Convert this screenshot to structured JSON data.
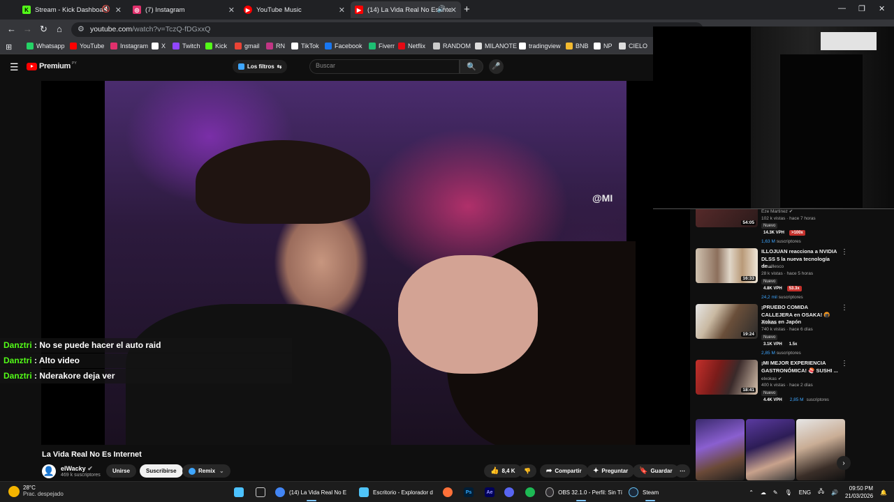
{
  "browser": {
    "tabs": [
      {
        "title": "Stream - Kick Dashboard",
        "icon": "kick-icon",
        "color": "#53fc18"
      },
      {
        "title": "(7) Instagram",
        "icon": "instagram-icon",
        "color": "#e1306c"
      },
      {
        "title": "YouTube Music",
        "icon": "youtube-music-icon",
        "color": "#ff0000"
      },
      {
        "title": "(14) La Vida Real No Es Inte",
        "icon": "youtube-icon",
        "color": "#ff0000",
        "active": true
      }
    ],
    "url_host": "youtube.com",
    "url_path": "/watch?v=TczQ-fDGxxQ",
    "bookmarks": [
      {
        "label": "Whatsapp",
        "color": "#25d366"
      },
      {
        "label": "YouTube",
        "color": "#ff0000"
      },
      {
        "label": "Instagram",
        "color": "#e1306c"
      },
      {
        "label": "X",
        "color": "#ffffff"
      },
      {
        "label": "Twitch",
        "color": "#9146ff"
      },
      {
        "label": "Kick",
        "color": "#53fc18"
      },
      {
        "label": "gmail",
        "color": "#ea4335"
      },
      {
        "label": "RN",
        "color": "#c13584"
      },
      {
        "label": "TikTok",
        "color": "#ffffff"
      },
      {
        "label": "Facebook",
        "color": "#1877f2"
      },
      {
        "label": "Fiverr",
        "color": "#1dbf73"
      },
      {
        "label": "Netflix",
        "color": "#e50914"
      },
      {
        "label": "RANDOM",
        "color": "#cccccc"
      },
      {
        "label": "MILANOTE",
        "color": "#dddddd"
      },
      {
        "label": "tradingview",
        "color": "#ffffff"
      },
      {
        "label": "BNB",
        "color": "#f3ba2f"
      },
      {
        "label": "NP",
        "color": "#ffffff"
      },
      {
        "label": "CIELO",
        "color": "#dddddd"
      }
    ]
  },
  "youtube": {
    "logo_text": "Premium",
    "logo_badge": "PY",
    "filter_label": "Los filtros",
    "search_placeholder": "Buscar"
  },
  "video": {
    "watermark": "@MI",
    "title": "La Vida Real No Es Internet",
    "channel": "elWacky",
    "subscribers": "469 k suscriptores",
    "join_label": "Unirse",
    "subscribe_label": "Suscribirse",
    "remix_label": "Remix",
    "likes": "8,4 K",
    "share_label": "Compartir",
    "ask_label": "Preguntar",
    "save_label": "Guardar"
  },
  "chat": [
    {
      "user": "Danztri",
      "message": "No se puede hacer el auto raid"
    },
    {
      "user": "Danztri",
      "message": "Alto video"
    },
    {
      "user": "Danztri",
      "message": "Nderakore deja ver"
    }
  ],
  "recommendations": [
    {
      "title": "",
      "channel": "Eze Martinez",
      "meta": "102 k vistas · hace 7 horas",
      "badge": "Nuevo",
      "vph": "14.3K VPH",
      "ratio": ">100x",
      "subs_num": "1,63 M",
      "subs_label": "suscriptores",
      "duration": "54:05"
    },
    {
      "title": "ILLOJUAN reacciona a NVIDIA DLSS 5 la nueva tecnología de...",
      "channel": "canalllesco",
      "meta": "28 k vistas · hace 5 horas",
      "badge": "Nuevo",
      "vph": "4.8K VPH",
      "ratio": "53.3x",
      "subs_num": "24,2 mil",
      "subs_label": "suscriptores",
      "duration": "16:33"
    },
    {
      "title": "¡PRUEBO COMIDA CALLEJERA en OSAKA! 🍘 Xokas en Japón",
      "channel": "elxokas",
      "meta": "740 k vistas · hace 6 días",
      "badge": "Nuevo",
      "vph": "3.1K VPH",
      "ratio": "1.5x",
      "subs_num": "2,85 M",
      "subs_label": "suscriptores",
      "duration": "19:24"
    },
    {
      "title": "¡MI MEJOR EXPERIENCIA GASTRONÓMICA! 🍣 SUSHI ...",
      "channel": "elxokas",
      "meta": "400 k vistas · hace 2 días",
      "badge": "Nuevo",
      "vph": "4.4K VPH",
      "ratio": "",
      "subs_num": "2,85 M",
      "subs_label": "suscriptores",
      "duration": "18:41"
    }
  ],
  "taskbar": {
    "temperature": "28°C",
    "condition": "Prac. despejado",
    "apps": [
      {
        "label": "(14) La Vida Real No E",
        "color": "#4285f4"
      },
      {
        "label": "Escritorio - Explorador d",
        "color": "#4fc3f7"
      },
      {
        "label": "OBS 32.1.0 - Perfil: Sin Tí",
        "color": "#302e31"
      },
      {
        "label": "Steam",
        "color": "#1b2838"
      }
    ],
    "language": "ENG",
    "time": "09:50 PM",
    "date": "21/03/2026"
  }
}
